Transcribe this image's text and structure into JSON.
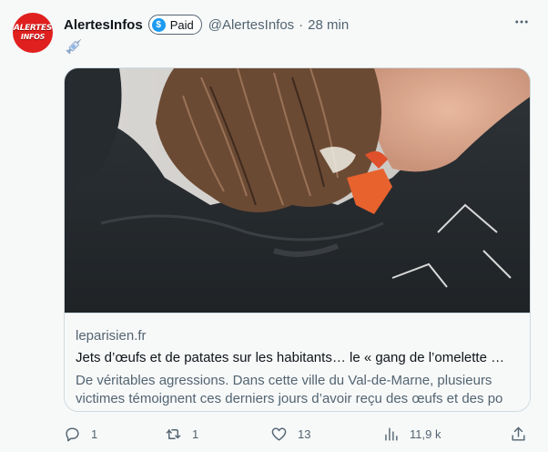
{
  "author": {
    "name": "AlertesInfos",
    "handle": "@AlertesInfos",
    "time": "28 min",
    "paid_badge": "Paid",
    "avatar_text_line1": "ALERTES",
    "avatar_text_line2": "INFOS"
  },
  "card": {
    "domain": "leparisien.fr",
    "headline": "Jets d’œufs et de patates sur les habitants… le « gang de l’omelette …",
    "description": "De véritables agressions. Dans cette ville du Val-de-Marne, plusieurs victimes témoignent ces derniers jours d’avoir reçu des œufs et des po"
  },
  "actions": {
    "replies": "1",
    "retweets": "1",
    "likes": "13",
    "views": "11,9 k"
  },
  "icons": {
    "more": "more-horizontal-icon",
    "syringe": "syringe-icon",
    "reply": "reply-icon",
    "retweet": "retweet-icon",
    "like": "heart-icon",
    "views": "views-icon",
    "share": "share-icon"
  },
  "colors": {
    "accent": "#1d9bf0",
    "avatar_bg": "#e0201f",
    "secondary_text": "#536471"
  }
}
